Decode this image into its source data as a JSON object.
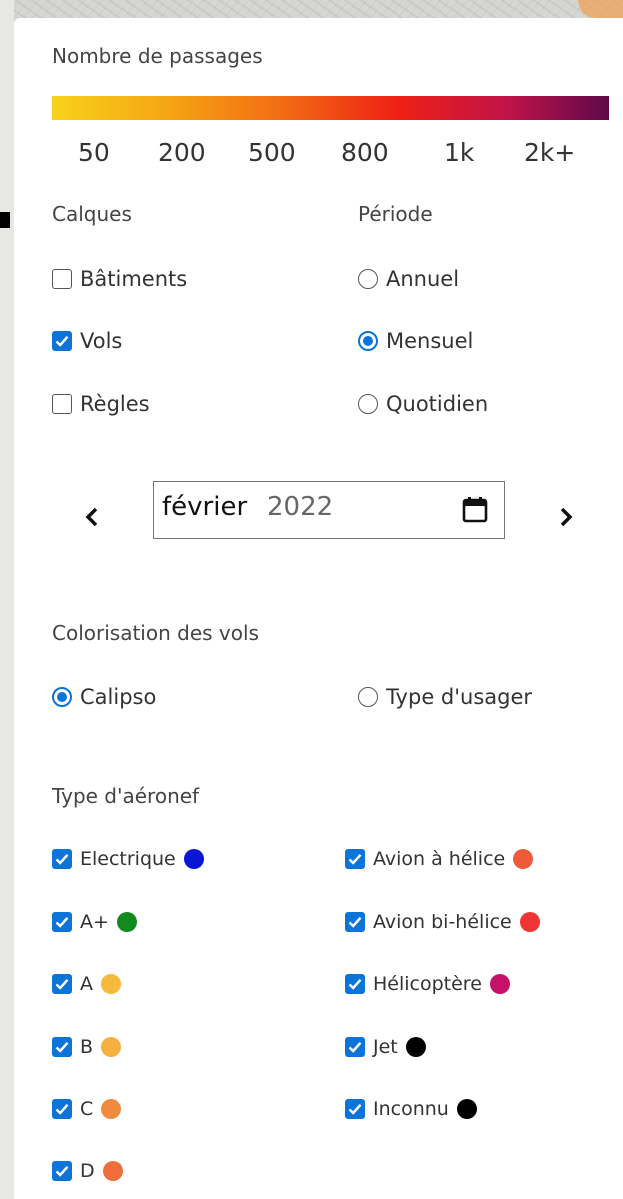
{
  "legend": {
    "title": "Nombre de passages",
    "ticks": [
      "50",
      "200",
      "500",
      "800",
      "1k",
      "2k+"
    ]
  },
  "layers": {
    "title": "Calques",
    "items": [
      {
        "label": "Bâtiments",
        "checked": false
      },
      {
        "label": "Vols",
        "checked": true
      },
      {
        "label": "Règles",
        "checked": false
      }
    ]
  },
  "period": {
    "title": "Période",
    "options": [
      {
        "label": "Annuel",
        "selected": false
      },
      {
        "label": "Mensuel",
        "selected": true
      },
      {
        "label": "Quotidien",
        "selected": false
      }
    ]
  },
  "date": {
    "month": "février",
    "year": "2022"
  },
  "coloring": {
    "title": "Colorisation des vols",
    "options": [
      {
        "label": "Calipso",
        "selected": true
      },
      {
        "label": "Type d'usager",
        "selected": false
      }
    ]
  },
  "aircraft": {
    "title": "Type d'aéronef",
    "left": [
      {
        "label": "Electrique",
        "checked": true,
        "color": "#0a16d6"
      },
      {
        "label": "A+",
        "checked": true,
        "color": "#138a1d"
      },
      {
        "label": "A",
        "checked": true,
        "color": "#f5b93b"
      },
      {
        "label": "B",
        "checked": true,
        "color": "#f5b040"
      },
      {
        "label": "C",
        "checked": true,
        "color": "#f08a3e"
      },
      {
        "label": "D",
        "checked": true,
        "color": "#ef6f3c"
      }
    ],
    "right": [
      {
        "label": "Avion à hélice",
        "checked": true,
        "color": "#ef5a3a"
      },
      {
        "label": "Avion bi-hélice",
        "checked": true,
        "color": "#ee3434"
      },
      {
        "label": "Hélicoptère",
        "checked": true,
        "color": "#c4126a"
      },
      {
        "label": "Jet",
        "checked": true,
        "color": "#000000"
      },
      {
        "label": "Inconnu",
        "checked": true,
        "color": "#000000"
      }
    ]
  },
  "colors": {
    "accent": "#0b74d8",
    "legend_gradient": [
      "#f7d21b",
      "#f6a713",
      "#f26a14",
      "#ef2015",
      "#c0124a",
      "#5d0a48"
    ]
  }
}
